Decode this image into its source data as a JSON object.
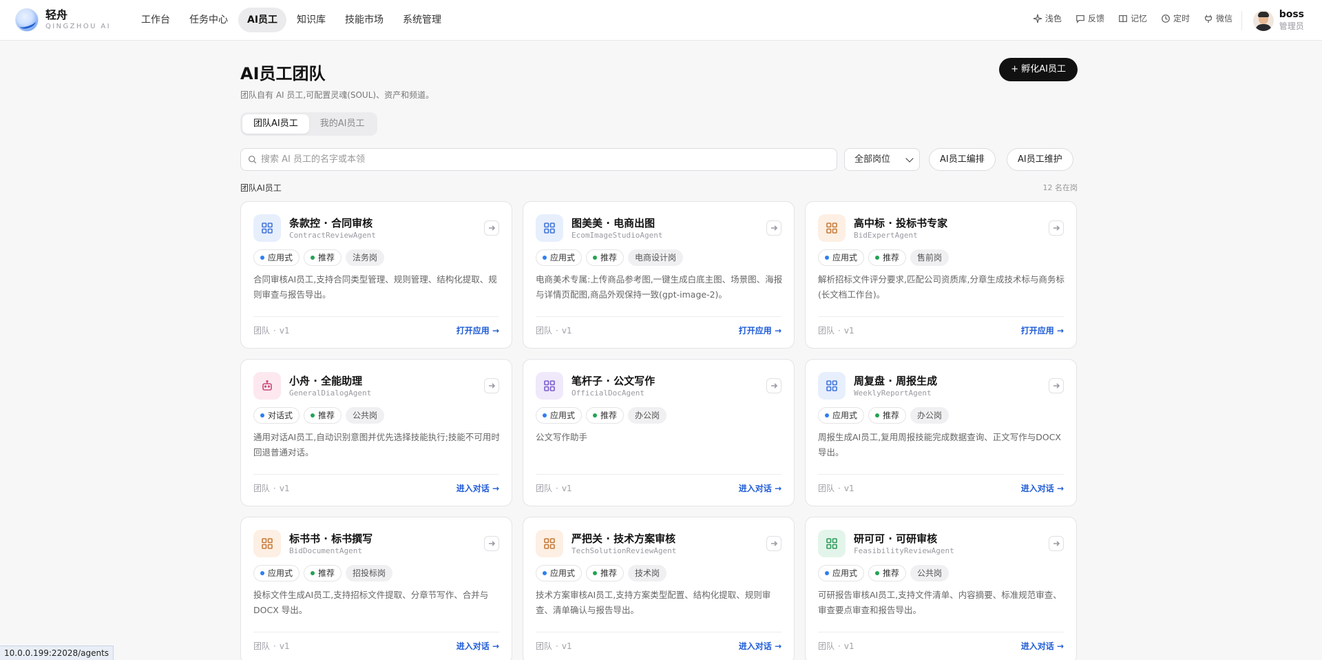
{
  "brand": {
    "name": "轻舟",
    "sub": "QINGZHOU AI"
  },
  "nav": [
    {
      "label": "工作台",
      "active": false
    },
    {
      "label": "任务中心",
      "active": false
    },
    {
      "label": "AI员工",
      "active": true
    },
    {
      "label": "知识库",
      "active": false
    },
    {
      "label": "技能市场",
      "active": false
    },
    {
      "label": "系统管理",
      "active": false
    }
  ],
  "tools": {
    "theme": "浅色",
    "feedback": "反馈",
    "memory": "记忆",
    "schedule": "定时",
    "wechat": "微信"
  },
  "user": {
    "name": "boss",
    "role": "管理员"
  },
  "page": {
    "title": "AI员工团队",
    "subtitle": "团队自有 AI 员工,可配置灵魂(SOUL)、资产和频道。",
    "hatch_button": "+ 孵化AI员工"
  },
  "segments": [
    {
      "label": "团队AI员工",
      "active": true
    },
    {
      "label": "我的AI员工",
      "active": false
    }
  ],
  "filters": {
    "search_placeholder": "搜索 AI 员工的名字或本领",
    "role_select": "全部岗位",
    "arrange_button": "AI员工编排",
    "maintain_button": "AI员工维护"
  },
  "section": {
    "label": "团队AI员工",
    "count": "12 名在岗"
  },
  "colors": {
    "accent": "#1e5bd6",
    "dot_blue": "#2f7ff0",
    "dot_green": "#22a352"
  },
  "cards": [
    {
      "title": "条款控 · 合同审核",
      "sub": "ContractReviewAgent",
      "icon": "grid-icon",
      "tone": "blue",
      "mode": "应用式",
      "rec": "推荐",
      "dept": "法务岗",
      "desc": "合同审核AI员工,支持合同类型管理、规则管理、结构化提取、规则审查与报告导出。",
      "scope": "团队",
      "version": "v1",
      "action": "打开应用 →"
    },
    {
      "title": "图美美 · 电商出图",
      "sub": "EcomImageStudioAgent",
      "icon": "grid-icon",
      "tone": "blue",
      "mode": "应用式",
      "rec": "推荐",
      "dept": "电商设计岗",
      "desc": "电商美术专属:上传商品参考图,一键生成白底主图、场景图、海报与详情页配图,商品外观保持一致(gpt-image-2)。",
      "scope": "团队",
      "version": "v1",
      "action": "打开应用 →"
    },
    {
      "title": "高中标 · 投标书专家",
      "sub": "BidExpertAgent",
      "icon": "grid-icon",
      "tone": "orange",
      "mode": "应用式",
      "rec": "推荐",
      "dept": "售前岗",
      "desc": "解析招标文件评分要求,匹配公司资质库,分章生成技术标与商务标(长文档工作台)。",
      "scope": "团队",
      "version": "v1",
      "action": "打开应用 →"
    },
    {
      "title": "小舟 · 全能助理",
      "sub": "GeneralDialogAgent",
      "icon": "robot-icon",
      "tone": "pink",
      "mode": "对话式",
      "rec": "推荐",
      "dept": "公共岗",
      "desc": "通用对话AI员工,自动识别意图并优先选择技能执行;技能不可用时回退普通对话。",
      "scope": "团队",
      "version": "v1",
      "action": "进入对话 →"
    },
    {
      "title": "笔杆子 · 公文写作",
      "sub": "OfficialDocAgent",
      "icon": "grid-icon",
      "tone": "purple",
      "mode": "应用式",
      "rec": "推荐",
      "dept": "办公岗",
      "desc": "公文写作助手",
      "scope": "团队",
      "version": "v1",
      "action": "进入对话 →"
    },
    {
      "title": "周复盘 · 周报生成",
      "sub": "WeeklyReportAgent",
      "icon": "grid-icon",
      "tone": "blue",
      "mode": "应用式",
      "rec": "推荐",
      "dept": "办公岗",
      "desc": "周报生成AI员工,复用周报技能完成数据查询、正文写作与DOCX 导出。",
      "scope": "团队",
      "version": "v1",
      "action": "进入对话 →"
    },
    {
      "title": "标书书 · 标书撰写",
      "sub": "BidDocumentAgent",
      "icon": "grid-icon",
      "tone": "orange",
      "mode": "应用式",
      "rec": "推荐",
      "dept": "招投标岗",
      "desc": "投标文件生成AI员工,支持招标文件提取、分章节写作、合并与DOCX 导出。",
      "scope": "团队",
      "version": "v1",
      "action": "进入对话 →"
    },
    {
      "title": "严把关 · 技术方案审核",
      "sub": "TechSolutionReviewAgent",
      "icon": "grid-icon",
      "tone": "orange",
      "mode": "应用式",
      "rec": "推荐",
      "dept": "技术岗",
      "desc": "技术方案审核AI员工,支持方案类型配置、结构化提取、规则审查、清单确认与报告导出。",
      "scope": "团队",
      "version": "v1",
      "action": "进入对话 →"
    },
    {
      "title": "研可可 · 可研审核",
      "sub": "FeasibilityReviewAgent",
      "icon": "grid-icon",
      "tone": "green",
      "mode": "应用式",
      "rec": "推荐",
      "dept": "公共岗",
      "desc": "可研报告审核AI员工,支持文件清单、内容摘要、标准规范审查、审查要点审查和报告导出。",
      "scope": "团队",
      "version": "v1",
      "action": "进入对话 →"
    }
  ],
  "status_url": "10.0.0.199:22028/agents"
}
